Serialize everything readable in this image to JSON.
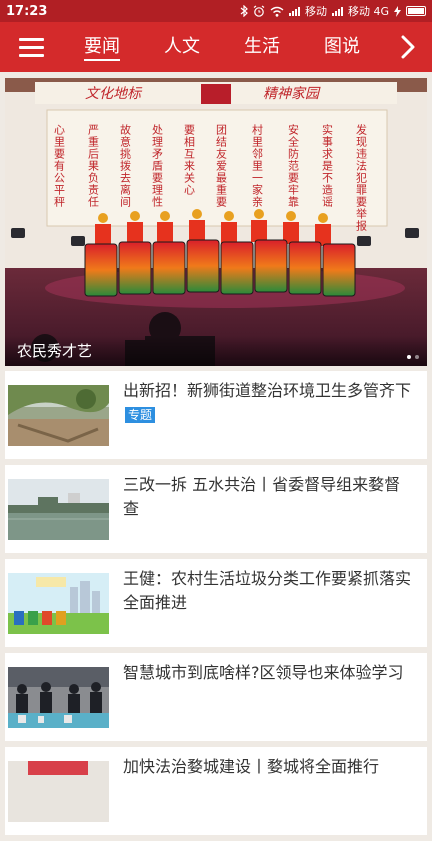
{
  "status_bar": {
    "time": "17:23",
    "carrier1": "移动",
    "carrier2": "移动 4G",
    "icons": [
      "bluetooth-icon",
      "alarm-icon",
      "wifi-icon",
      "signal-icon",
      "charging-icon",
      "battery-icon"
    ]
  },
  "nav": {
    "tabs": [
      {
        "label": "要闻",
        "active": true
      },
      {
        "label": "人文",
        "active": false
      },
      {
        "label": "生活",
        "active": false
      },
      {
        "label": "图说",
        "active": false
      }
    ],
    "menu_icon": "hamburger-menu-icon",
    "more_icon": "chevron-right-icon",
    "colors": {
      "bar": "#d42a2b",
      "status": "#b11f24"
    }
  },
  "banner": {
    "caption": "农民秀才艺",
    "slide_count": 2,
    "active_slide": 1,
    "stage_sign_left": "文化地标",
    "stage_sign_right": "精神家园",
    "stage_banners": [
      "心里要有公平秤",
      "严重后果负责任",
      "故意挑拨去离间",
      "处理矛盾要理性",
      "要相互来关心",
      "团结友爱最重要",
      "村里邻里一家亲",
      "安全防范要牢靠",
      "实事求是不造谣",
      "发现违法犯罪要举报"
    ]
  },
  "news": [
    {
      "title": "出新招！新狮街道整治环境卫生多管齐下",
      "tag": "专题",
      "thumb": "road-construction-photo"
    },
    {
      "title": "三改一拆 五水共治丨省委督导组来婺督查",
      "tag": "",
      "thumb": "river-landscape-photo"
    },
    {
      "title": "王健：农村生活垃圾分类工作要紧抓落实全面推进",
      "tag": "",
      "thumb": "garbage-sorting-illustration"
    },
    {
      "title": "智慧城市到底啥样?区领导也来体验学习",
      "tag": "",
      "thumb": "city-model-visit-photo"
    },
    {
      "title": "加快法治婺城建设丨婺城将全面推行",
      "tag": "",
      "thumb": "law-event-photo"
    }
  ]
}
